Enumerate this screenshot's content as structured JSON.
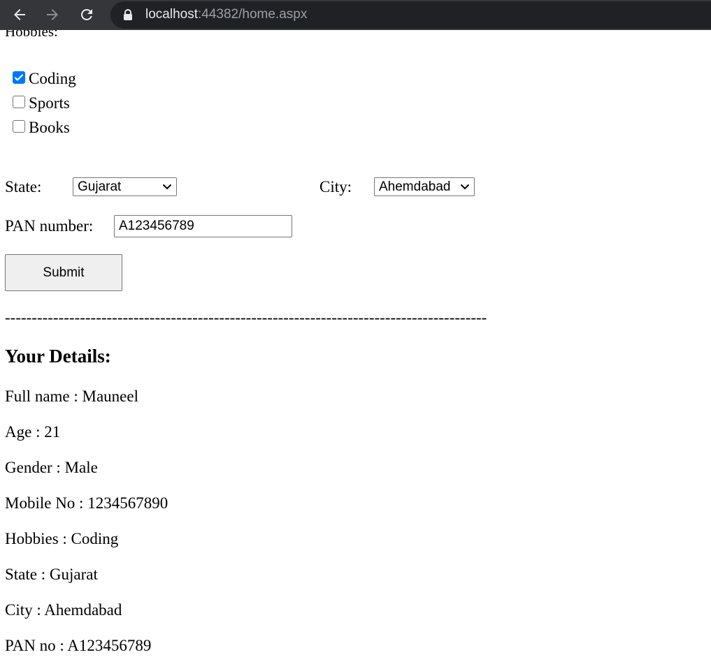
{
  "browser": {
    "url_host": "localhost",
    "url_rest": ":44382/home.aspx"
  },
  "form": {
    "hobbies_label": "Hobbies:",
    "hobbies": [
      {
        "label": "Coding",
        "checked": true
      },
      {
        "label": "Sports",
        "checked": false
      },
      {
        "label": "Books",
        "checked": false
      }
    ],
    "state_label": "State:",
    "state_value": "Gujarat",
    "city_label": "City:",
    "city_value": "Ahemdabad",
    "pan_label": "PAN number:",
    "pan_value": "A123456789",
    "submit_label": "Submit"
  },
  "divider": "------------------------------------------------------------------------------------------",
  "details": {
    "heading": "Your Details:",
    "lines": [
      "Full name : Mauneel",
      "Age : 21",
      "Gender : Male",
      "Mobile No : 1234567890",
      "Hobbies : Coding",
      "State : Gujarat",
      "City : Ahemdabad",
      "PAN no : A123456789"
    ]
  }
}
